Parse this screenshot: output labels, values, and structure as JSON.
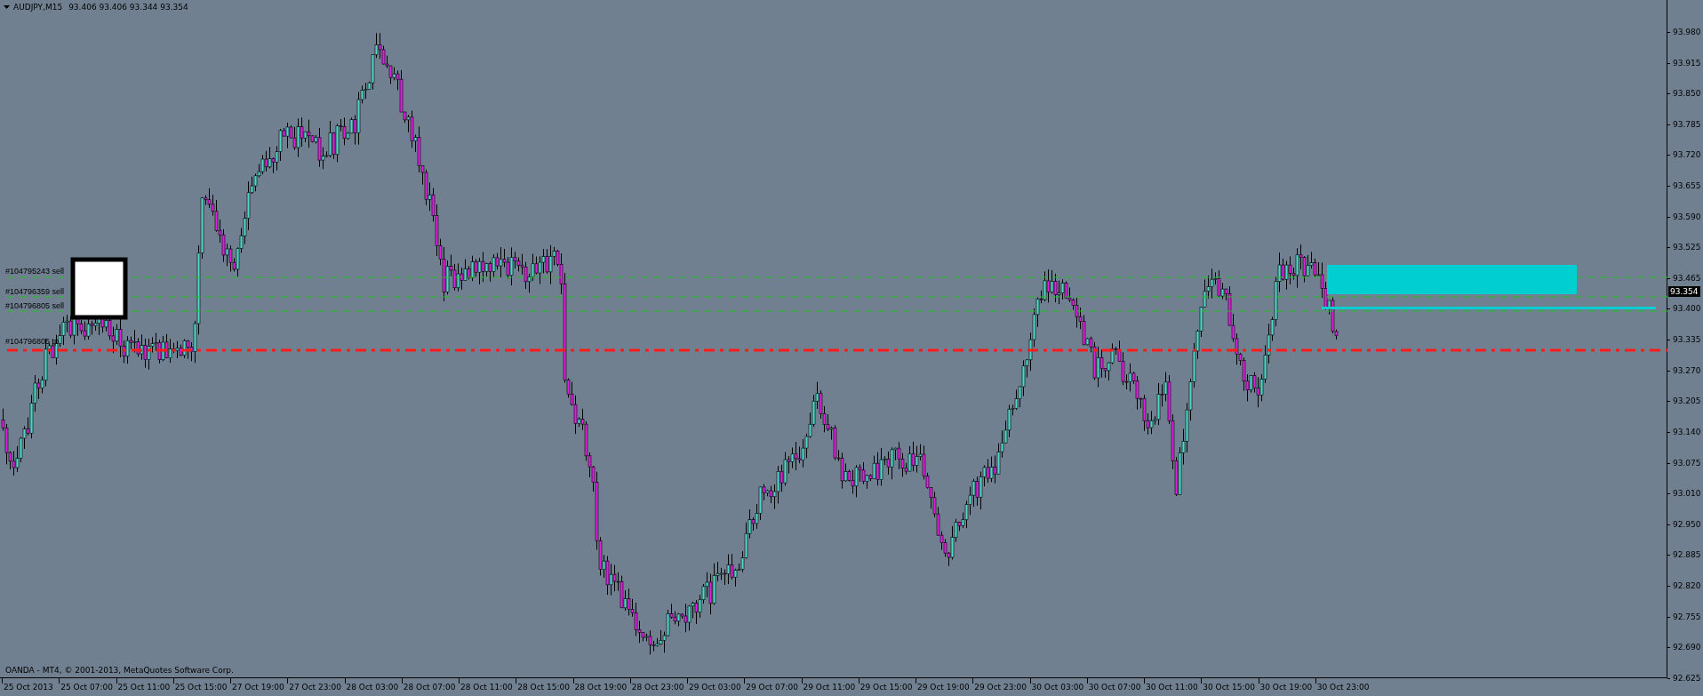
{
  "chart": {
    "symbol": "AUDJPY,M15",
    "ohlc": "93.406 93.406 93.344 93.354",
    "copyright": "OANDA - MT4, © 2001-2013, MetaQuotes Software Corp."
  },
  "orders": [
    {
      "label": "#104795243 sell",
      "kind": "sell"
    },
    {
      "label": "#104796359 sell",
      "kind": "sell"
    },
    {
      "label": "#104796805 sell",
      "kind": "sell"
    },
    {
      "label": "#104796805 tp",
      "kind": "tp"
    }
  ],
  "price_axis": [
    "93.980",
    "93.915",
    "93.850",
    "93.785",
    "93.720",
    "93.655",
    "93.590",
    "93.525",
    "93.465",
    "93.400",
    "93.335",
    "93.270",
    "93.205",
    "93.140",
    "93.075",
    "93.010",
    "92.950",
    "92.885",
    "92.820",
    "92.755",
    "92.690",
    "92.625"
  ],
  "current_price": "93.354",
  "time_axis": [
    "25 Oct 2013",
    "25 Oct 07:00",
    "25 Oct 11:00",
    "25 Oct 15:00",
    "27 Oct 19:00",
    "27 Oct 23:00",
    "28 Oct 03:00",
    "28 Oct 07:00",
    "28 Oct 11:00",
    "28 Oct 15:00",
    "28 Oct 19:00",
    "28 Oct 23:00",
    "29 Oct 03:00",
    "29 Oct 07:00",
    "29 Oct 11:00",
    "29 Oct 15:00",
    "29 Oct 19:00",
    "29 Oct 23:00",
    "30 Oct 03:00",
    "30 Oct 07:00",
    "30 Oct 11:00",
    "30 Oct 15:00",
    "30 Oct 19:00",
    "30 Oct 23:00"
  ]
}
